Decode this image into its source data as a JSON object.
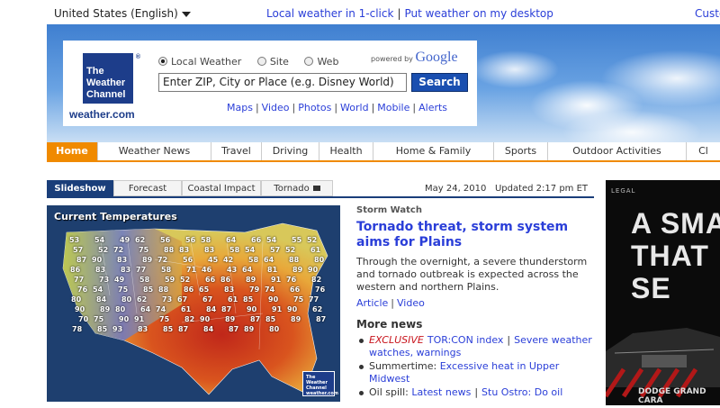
{
  "top": {
    "locale": "United States (English)",
    "links": [
      "Local weather in 1-click",
      "Put weather on my desktop"
    ],
    "custom": "Customize"
  },
  "logo": {
    "line1": "The",
    "line2": "Weather",
    "line3": "Channel",
    "url": "weather.com"
  },
  "search": {
    "radios": [
      {
        "label": "Local Weather",
        "selected": true
      },
      {
        "label": "Site",
        "selected": false
      },
      {
        "label": "Web",
        "selected": false
      }
    ],
    "powered_by": "powered by",
    "google": "Google",
    "placeholder": "Enter ZIP, City or Place (e.g. Disney World)",
    "button": "Search",
    "sublinks": [
      "Maps",
      "Video",
      "Photos",
      "World",
      "Mobile",
      "Alerts"
    ]
  },
  "nav": [
    "Home",
    "Weather News",
    "Travel",
    "Driving",
    "Health",
    "Home & Family",
    "Sports",
    "Outdoor Activities",
    "Cl"
  ],
  "tabs": [
    "Slideshow",
    "Forecast",
    "Coastal Impact",
    "Tornado"
  ],
  "date": "May 24, 2010",
  "updated": "Updated 2:17 pm ET",
  "map": {
    "title": "Current Temperatures",
    "logo": "The Weather Channel weather.com",
    "temps": [
      "53",
      "54",
      "49",
      "62",
      "56",
      "56",
      "58",
      "64",
      "66",
      "54",
      "55",
      "52",
      "57",
      "52",
      "72",
      "75",
      "88",
      "83",
      "83",
      "58",
      "54",
      "57",
      "52",
      "61",
      "87",
      "90",
      "83",
      "89",
      "72",
      "56",
      "45",
      "42",
      "58",
      "64",
      "88",
      "80",
      "86",
      "83",
      "83",
      "77",
      "58",
      "71",
      "46",
      "43",
      "64",
      "81",
      "89",
      "90",
      "77",
      "73",
      "49",
      "58",
      "59",
      "52",
      "66",
      "86",
      "89",
      "91",
      "76",
      "82",
      "76",
      "54",
      "75",
      "85",
      "88",
      "86",
      "65",
      "83",
      "79",
      "74",
      "66",
      "76",
      "80",
      "84",
      "80",
      "62",
      "73",
      "67",
      "67",
      "61",
      "85",
      "90",
      "75",
      "77",
      "90",
      "89",
      "80",
      "64",
      "74",
      "61",
      "84",
      "87",
      "90",
      "91",
      "90",
      "62",
      "70",
      "75",
      "90",
      "91",
      "75",
      "82",
      "90",
      "89",
      "87",
      "85",
      "89",
      "87",
      "78",
      "85",
      "93",
      "83",
      "85",
      "87",
      "84",
      "87",
      "89",
      "80"
    ]
  },
  "story": {
    "kicker": "Storm Watch",
    "headline": "Tornado threat, storm system aims for Plains",
    "dek": "Through the overnight, a severe thunderstorm and tornado outbreak is expected across the western and northern Plains.",
    "links": [
      "Article",
      "Video"
    ],
    "more_news": "More news",
    "news": [
      {
        "exclusive": "Exclusive",
        "text": "TOR:CON index",
        "text2": "Severe weather watches, warnings"
      },
      {
        "prefix": "Summertime:",
        "text": "Excessive heat in Upper Midwest"
      },
      {
        "prefix": "Oil spill:",
        "text": "Latest news",
        "text2": "Stu Ostro: Do oil"
      }
    ]
  },
  "ad": {
    "legal": "LEGAL",
    "headline": "A SMA THAT SE",
    "brand": "DODGE GRAND CARA"
  }
}
